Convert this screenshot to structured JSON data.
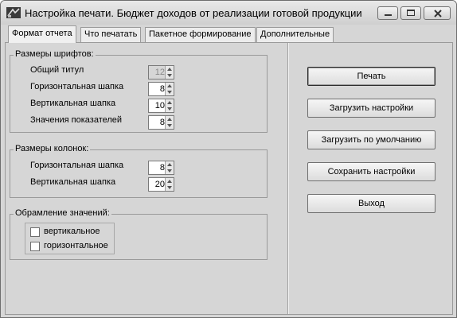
{
  "window": {
    "title": "Настройка печати. Бюджет доходов от реализации готовой продукции",
    "controls": [
      "minimize-icon",
      "maximize-icon",
      "close-icon"
    ]
  },
  "tabs": [
    {
      "label": "Формат отчета",
      "active": true
    },
    {
      "label": "Что печатать",
      "active": false
    },
    {
      "label": "Пакетное формирование",
      "active": false
    },
    {
      "label": "Дополнительные",
      "active": false
    }
  ],
  "font_sizes": {
    "title": "Размеры шрифтов:",
    "fields": [
      {
        "label": "Общий титул",
        "value": "12",
        "enabled": false
      },
      {
        "label": "Горизонтальная шапка",
        "value": "8",
        "enabled": true
      },
      {
        "label": "Вертикальная шапка",
        "value": "10",
        "enabled": true
      },
      {
        "label": "Значения показателей",
        "value": "8",
        "enabled": true
      }
    ]
  },
  "column_sizes": {
    "title": "Размеры колонок:",
    "fields": [
      {
        "label": "Горизонтальная шапка",
        "value": "8"
      },
      {
        "label": "Вертикальная шапка",
        "value": "20"
      }
    ]
  },
  "framing": {
    "title": "Обрамление значений:",
    "options": [
      {
        "label": "вертикальное",
        "checked": false
      },
      {
        "label": "горизонтальное",
        "checked": false
      }
    ]
  },
  "buttons": {
    "print": "Печать",
    "load": "Загрузить настройки",
    "load_default": "Загрузить по умолчанию",
    "save": "Сохранить настройки",
    "exit": "Выход"
  }
}
